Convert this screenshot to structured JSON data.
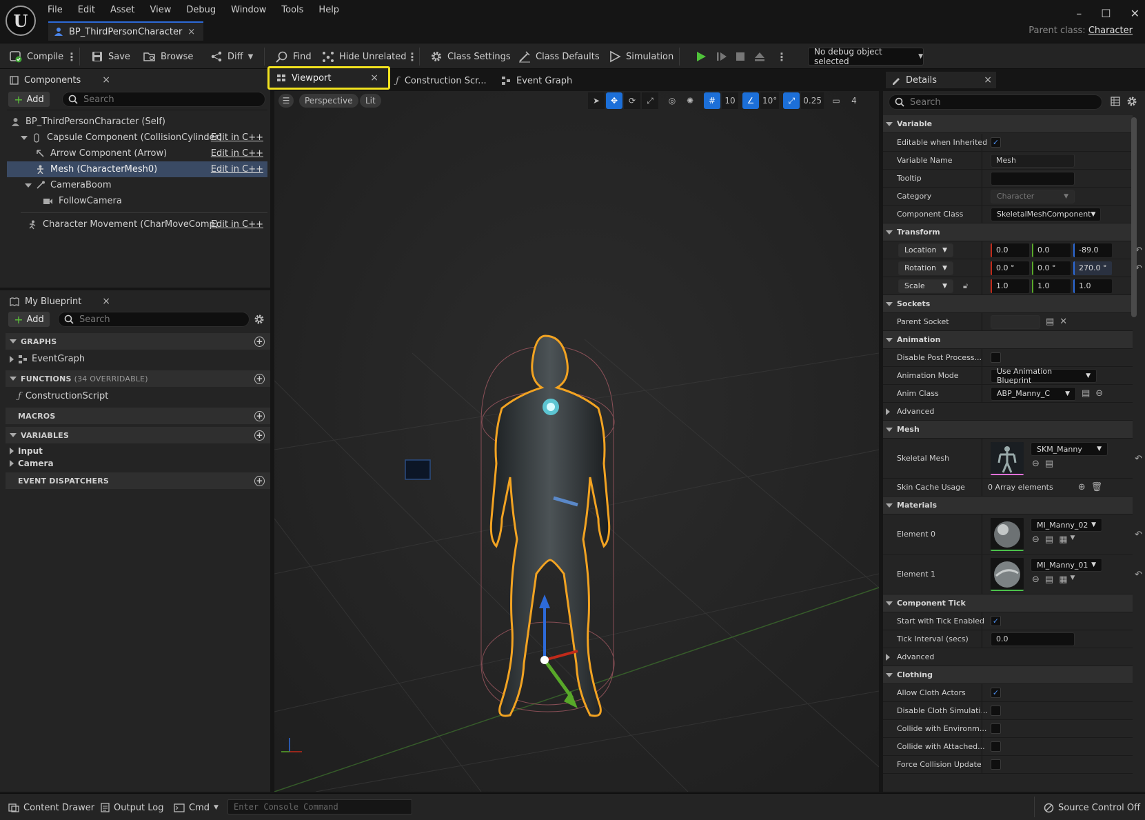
{
  "app": {
    "logo_letter": "U",
    "menu": [
      "File",
      "Edit",
      "Asset",
      "View",
      "Debug",
      "Window",
      "Tools",
      "Help"
    ],
    "document_tab": "BP_ThirdPersonCharacter",
    "parent_class_label": "Parent class:",
    "parent_class_value": "Character",
    "window_controls": [
      "–",
      "☐",
      "✕"
    ]
  },
  "toolbar": {
    "compile": "Compile",
    "save": "Save",
    "browse": "Browse",
    "diff": "Diff",
    "find": "Find",
    "hide_unrelated": "Hide Unrelated",
    "class_settings": "Class Settings",
    "class_defaults": "Class Defaults",
    "simulation": "Simulation",
    "debug_object": "No debug object selected"
  },
  "components": {
    "tab": "Components",
    "add": "Add",
    "search_placeholder": "Search",
    "edit_cpp": "Edit in C++",
    "tree": [
      {
        "label": "BP_ThirdPersonCharacter (Self)"
      },
      {
        "label": "Capsule Component (CollisionCylinder)"
      },
      {
        "label": "Arrow Component (Arrow)"
      },
      {
        "label": "Mesh (CharacterMesh0)"
      },
      {
        "label": "CameraBoom"
      },
      {
        "label": "FollowCamera"
      },
      {
        "label": "Character Movement (CharMoveComp)"
      }
    ]
  },
  "my_blueprint": {
    "tab": "My Blueprint",
    "add": "Add",
    "search_placeholder": "Search",
    "graphs": "GRAPHS",
    "event_graph": "EventGraph",
    "functions": "FUNCTIONS",
    "functions_count": "(34 OVERRIDABLE)",
    "construction_script": "ConstructionScript",
    "macros": "MACROS",
    "variables": "VARIABLES",
    "var_input": "Input",
    "var_camera": "Camera",
    "event_dispatchers": "EVENT DISPATCHERS"
  },
  "viewport": {
    "tabs": [
      "Viewport",
      "Construction Scr...",
      "Event Graph"
    ],
    "perspective": "Perspective",
    "lit": "Lit",
    "grid_snap": "10",
    "rot_snap": "10°",
    "scale_snap": "0.25",
    "camera_speed": "4",
    "highlight_color": "#f2e31f"
  },
  "details": {
    "tab": "Details",
    "search_placeholder": "Search",
    "sec_variable": "Variable",
    "editable_inherited": "Editable when Inherited",
    "variable_name": "Variable Name",
    "variable_name_value": "Mesh",
    "tooltip": "Tooltip",
    "category": "Category",
    "category_value": "Character",
    "component_class": "Component Class",
    "component_class_value": "SkeletalMeshComponent",
    "sec_transform": "Transform",
    "location": "Location",
    "location_values": [
      "0.0",
      "0.0",
      "-89.0"
    ],
    "rotation": "Rotation",
    "rotation_values": [
      "0.0 °",
      "0.0 °",
      "270.0 °"
    ],
    "scale": "Scale",
    "scale_values": [
      "1.0",
      "1.0",
      "1.0"
    ],
    "sec_sockets": "Sockets",
    "parent_socket": "Parent Socket",
    "sec_animation": "Animation",
    "disable_post_process": "Disable Post Process...",
    "animation_mode": "Animation Mode",
    "animation_mode_value": "Use Animation Blueprint",
    "anim_class": "Anim Class",
    "anim_class_value": "ABP_Manny_C",
    "advanced": "Advanced",
    "sec_mesh": "Mesh",
    "skeletal_mesh": "Skeletal Mesh",
    "skeletal_mesh_value": "SKM_Manny",
    "skin_cache_usage": "Skin Cache Usage",
    "skin_cache_value": "0 Array elements",
    "sec_materials": "Materials",
    "element0": "Element 0",
    "element0_value": "MI_Manny_02",
    "element1": "Element 1",
    "element1_value": "MI_Manny_01",
    "sec_component_tick": "Component Tick",
    "start_tick": "Start with Tick Enabled",
    "tick_interval": "Tick Interval (secs)",
    "tick_interval_value": "0.0",
    "advanced2": "Advanced",
    "sec_clothing": "Clothing",
    "allow_cloth": "Allow Cloth Actors",
    "disable_cloth": "Disable Cloth Simulati...",
    "collide_env": "Collide with Environm...",
    "collide_attached": "Collide with Attached...",
    "force_collision": "Force Collision Update"
  },
  "statusbar": {
    "content_drawer": "Content Drawer",
    "output_log": "Output Log",
    "cmd": "Cmd",
    "console_placeholder": "Enter Console Command",
    "source_control": "Source Control Off"
  }
}
